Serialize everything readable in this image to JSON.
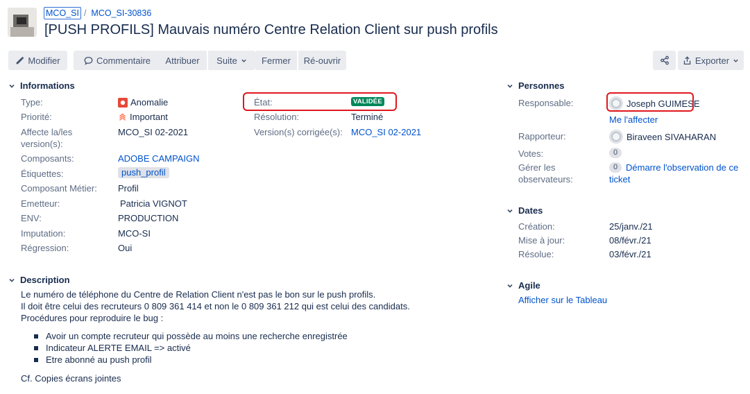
{
  "breadcrumb": {
    "project": "MCO_SI",
    "separator": "/",
    "issue_key": "MCO_SI-30836"
  },
  "issue_title": "[PUSH PROFILS] Mauvais numéro Centre Relation Client sur push profils",
  "toolbar": {
    "edit": "Modifier",
    "comment": "Commentaire",
    "assign": "Attribuer",
    "more": "Suite",
    "close": "Fermer",
    "reopen": "Ré-ouvrir",
    "export": "Exporter"
  },
  "details": {
    "header": "Informations",
    "type_label": "Type:",
    "type_value": "Anomalie",
    "priority_label": "Priorité:",
    "priority_value": "Important",
    "affects_label_1": "Affecte la/les",
    "affects_label_2": "version(s):",
    "affects_value": "MCO_SI 02-2021",
    "components_label": "Composants:",
    "components_value": "ADOBE CAMPAIGN",
    "labels_label": "Étiquettes:",
    "labels_value": "push_profil",
    "business_label": "Composant Métier:",
    "business_value": "Profil",
    "emitter_label": "Emetteur:",
    "emitter_value": "Patricia VIGNOT",
    "env_label": "ENV:",
    "env_value": "PRODUCTION",
    "imputation_label": "Imputation:",
    "imputation_value": "MCO-SI",
    "regression_label": "Régression:",
    "regression_value": "Oui",
    "status_label": "État:",
    "status_value": "VALIDÉE",
    "resolution_label": "Résolution:",
    "resolution_value": "Terminé",
    "fix_label": "Version(s) corrigée(s):",
    "fix_value": "MCO_SI 02-2021"
  },
  "description": {
    "header": "Description",
    "lines": [
      "Le numéro de téléphone du Centre de Relation Client n'est pas le bon sur le push profils.",
      "Il doit être celui des recruteurs 0 809 361 414 et non le 0 809 361 212 qui est celui des candidats.",
      "Procédures pour reproduire le bug :"
    ],
    "bullets": [
      "Avoir un compte recruteur qui possède au moins une recherche enregistrée",
      "Indicateur ALERTE EMAIL => activé",
      "Etre abonné au push profil"
    ],
    "footer": "Cf. Copies écrans jointes"
  },
  "people": {
    "header": "Personnes",
    "assignee_label": "Responsable:",
    "assignee_value": "Joseph GUIMESE",
    "assign_me": "Me l'affecter",
    "reporter_label": "Rapporteur:",
    "reporter_value": "Biraveen SIVAHARAN",
    "votes_label": "Votes:",
    "votes_count": "0",
    "watchers_label_1": "Gérer les",
    "watchers_label_2": "observateurs:",
    "watchers_count": "0",
    "watch_link_1": "Démarre l'observation de ce",
    "watch_link_2": "ticket"
  },
  "dates": {
    "header": "Dates",
    "created_label": "Création:",
    "created_value": "25/janv./21",
    "updated_label": "Mise à jour:",
    "updated_value": "08/févr./21",
    "resolved_label": "Résolue:",
    "resolved_value": "03/févr./21"
  },
  "agile": {
    "header": "Agile",
    "board_link": "Afficher sur le Tableau"
  },
  "colors": {
    "link": "#0052cc",
    "status_green": "#00875a",
    "highlight_red": "#e0161d"
  }
}
